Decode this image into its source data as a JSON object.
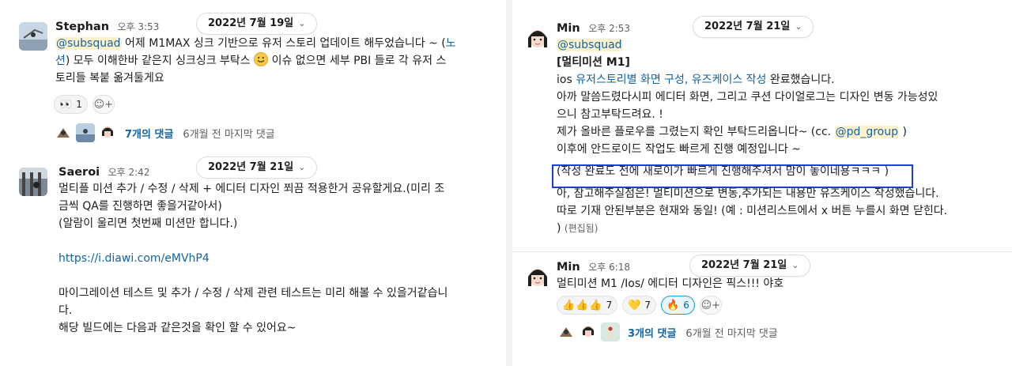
{
  "colors": {
    "mention_bg": "#fdf2cc",
    "link": "#1264a3",
    "highlight_border": "#1a3fd6",
    "reaction_own_bg": "#e8f5fa"
  },
  "left": {
    "messages": [
      {
        "author": "Stephan",
        "time": "오후 3:53",
        "date_divider": "2022년 7월 19일",
        "mention": "@subsquad",
        "line1_rest": " 어제 M1MAX 싱크 기반으로 유저 스토리 업데이트 해두었습니다 ~ (",
        "line1_link": "노",
        "line2_link": "션",
        "line2_before_emoji": ") 모두 이해한바 같은지 싱크싱크 부탁스 ",
        "line2_after_emoji": " 이슈 없으면 세부 PBI 들로 각 유저 스",
        "line3": "토리들 복붙 옮겨둘게요",
        "reaction": {
          "emoji_icon": "eyes-icon",
          "emoji": "👀",
          "count": "1"
        },
        "thread": {
          "replies": "7개의 댓글",
          "last_reply": "6개월 전 마지막 댓글"
        }
      },
      {
        "author": "Saeroi",
        "time": "오후 2:42",
        "date_divider": "2022년 7월 21일",
        "lines": [
          "멀티플 미션 추가 / 수정 / 삭제 + 에디터 디자인 쬐끔 적용한거 공유할게요.(미리 조",
          "금씩 QA를 진행하면 좋을거같아서)",
          "(알람이 울리면 첫번째 미션만 합니다.)"
        ],
        "link": "https://i.diawi.com/eMVhP4",
        "lines2": [
          "마이그레이션 테스트 및 추가 / 수정 / 삭제 관련 테스트는 미리 해볼 수 있을거같습니",
          "다.",
          "해당 빌드에는 다음과 같은것을 확인 할 수 있어요~"
        ]
      }
    ]
  },
  "right": {
    "messages": [
      {
        "author": "Min",
        "time": "오후 2:53",
        "date_divider": "2022년 7월 21일",
        "mention": "@subsquad",
        "title": "[멀티미션 M1]",
        "line_ios_prefix": "ios ",
        "line_ios_link": "유저스토리별 화면 구성, 유즈케이스 작성",
        "line_ios_suffix": " 완료했습니다.",
        "line_a": "아까 말씀드렸다시피 에디터 화면, 그리고 쿠션 다이얼로그는 디자인 변동 가능성있",
        "line_b": "으니 참고부탁드려요. !",
        "line_c_prefix": "제가 올바른 플로우를 그렸는지 확인 부탁드리옵니다~ (cc. ",
        "line_c_mention": "@pd_group",
        "line_c_suffix": " )",
        "line_d": "이후에 안드로이드 작업도 빠르게 진행 예정입니다 ~",
        "line_highlight": "(작성 완료도 전에 새로이가 빠르게 진행해주셔서 맘이 놓이네용ㅋㅋㅋ )",
        "line_e": "아, 참고해주실점은! 멀티미션으로 변동,추가되는 내용만 유즈케이스 작성했습니다.",
        "line_f": "따로 기재 안된부분은 현재와 동일! (예 : 미션리스트에서 x 버튼 누를시 화면 닫힌다.",
        "line_g_prefix": ")",
        "edited": "(편집됨)"
      },
      {
        "author": "Min",
        "time": "오후 6:18",
        "date_divider": "2022년 7월 21일",
        "text": "멀티미션 M1 /Ios/ 에디터 디자인은 픽스!!! 야호",
        "reactions": [
          {
            "emoji_icon": "thumbs-up-icon",
            "emoji": "👍👍👍",
            "count": "7"
          },
          {
            "emoji_icon": "yellow-heart-icon",
            "emoji": "💛",
            "count": "7"
          },
          {
            "emoji_icon": "fire-icon",
            "emoji": "🔥",
            "count": "6"
          }
        ],
        "thread": {
          "replies": "3개의 댓글",
          "last_reply": "6개월 전 마지막 댓글"
        }
      }
    ]
  }
}
